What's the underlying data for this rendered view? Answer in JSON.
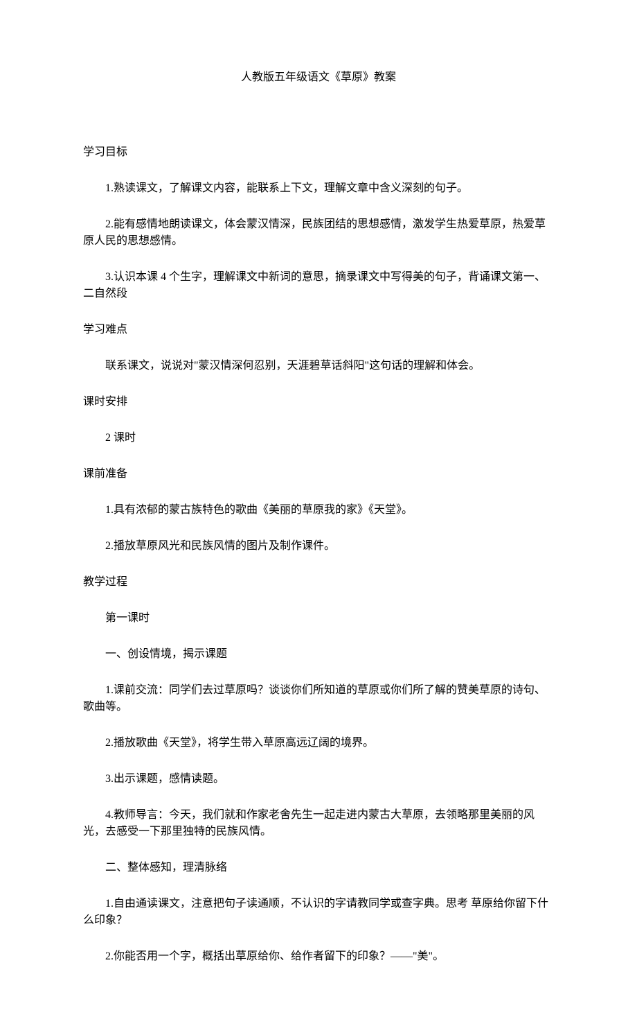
{
  "title": "人教版五年级语文《草原》教案",
  "sections": {
    "goals_heading": "学习目标",
    "goals": {
      "g1": "1.熟读课文，了解课文内容，能联系上下文，理解文章中含义深刻的句子。",
      "g2": "2.能有感情地朗读课文，体会蒙汉情深，民族团结的思想感情，激发学生热爱草原，热爱草原人民的思想感情。",
      "g3": "3.认识本课 4 个生字，理解课文中新词的意思，摘录课文中写得美的句子，背诵课文第一、二自然段"
    },
    "difficulty_heading": "学习难点",
    "difficulty": "联系课文，说说对\"蒙汉情深何忍别，天涯碧草话斜阳\"这句话的理解和体会。",
    "schedule_heading": "课时安排",
    "schedule": "2 课时",
    "prep_heading": "课前准备",
    "prep": {
      "p1": "1.具有浓郁的蒙古族特色的歌曲《美丽的草原我的家》《天堂》。",
      "p2": "2.播放草原风光和民族风情的图片及制作课件。"
    },
    "process_heading": "教学过程",
    "lesson1_heading": "第一课时",
    "sec1_heading": "一、创设情境，揭示课题",
    "sec1": {
      "s1": "1.课前交流：同学们去过草原吗？谈谈你们所知道的草原或你们所了解的赞美草原的诗句、歌曲等。",
      "s2": "2.播放歌曲《天堂》，将学生带入草原高远辽阔的境界。",
      "s3": "3.出示课题，感情读题。",
      "s4": "4.教师导言：今天，我们就和作家老舍先生一起走进内蒙古大草原，去领略那里美丽的风光，去感受一下那里独特的民族风情。"
    },
    "sec2_heading": "二、整体感知，理清脉络",
    "sec2": {
      "s1": "1.自由通读课文，注意把句子读通顺，不认识的字请教同学或查字典。思考 草原给你留下什么印象？",
      "s2": "2.你能否用一个字，概括出草原给你、给作者留下的印象？——\"美\"。"
    }
  }
}
